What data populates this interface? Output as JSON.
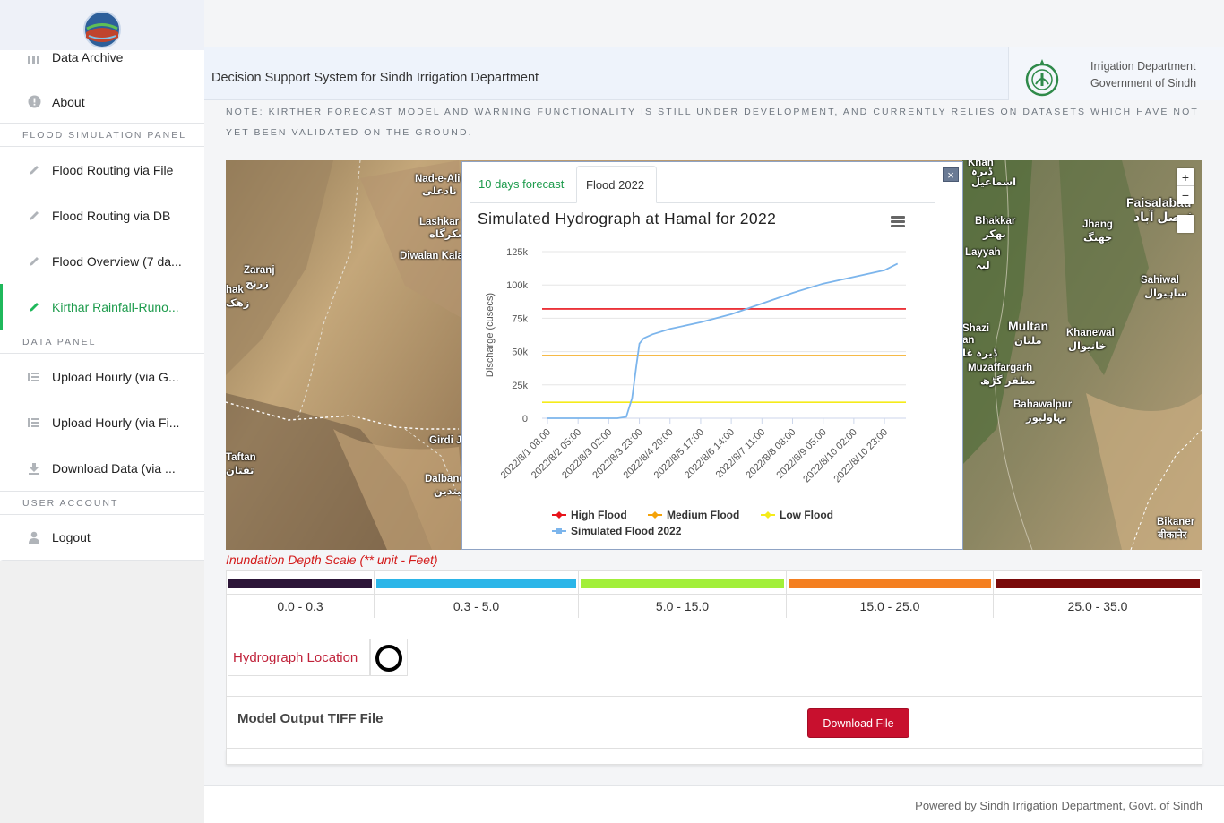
{
  "sidebar": {
    "items_top": [
      {
        "label": "Data Archive",
        "icon": "bar-icon"
      },
      {
        "label": "About",
        "icon": "info-icon"
      }
    ],
    "section_flood": "FLOOD SIMULATION PANEL",
    "flood_items": [
      {
        "label": "Flood Routing via File"
      },
      {
        "label": "Flood Routing via DB"
      },
      {
        "label": "Flood Overview (7 da..."
      },
      {
        "label": "Kirthar Rainfall-Runo..."
      }
    ],
    "section_data": "DATA PANEL",
    "data_items": [
      {
        "label": "Upload Hourly (via G..."
      },
      {
        "label": "Upload Hourly (via Fi..."
      },
      {
        "label": "Download Data (via ..."
      }
    ],
    "section_user": "USER ACCOUNT",
    "user_items": [
      {
        "label": "Logout"
      }
    ]
  },
  "header": {
    "title": "Decision Support System for Sindh Irrigation Department",
    "dept_line1": "Irrigation Department",
    "dept_line2": "Government of Sindh"
  },
  "note": "NOTE: KIRTHER FORECAST MODEL AND WARNING FUNCTIONALITY IS STILL UNDER DEVELOPMENT, AND CURRENTLY RELIES ON DATASETS WHICH HAVE NOT YET BEEN VALIDATED ON THE GROUND.",
  "map": {
    "zoom_in": "+",
    "zoom_out": "−",
    "labels_left": [
      "Nad-e-Ali",
      "نادعلی",
      "Lashkar",
      "لشکرگاه",
      "Diwalan Kala",
      "Zaranj",
      "زرنج",
      "hak",
      "زهک",
      "Girdi J",
      "Dalband",
      "دالبندین",
      "Taftan",
      "تفتان"
    ],
    "labels_right": [
      "Khan",
      "ڈیرہ",
      "اسماعیل",
      "Faisalabad",
      "فیصل آباد",
      "Bhakkar",
      "بھکر",
      "Jhang",
      "جھنگ",
      "Layyah",
      "لیہ",
      "Sahiwal",
      "ساہیوال",
      "Shazi",
      "an",
      "Multan",
      "ملتان",
      "Khanewal",
      "خانیوال",
      "Muzaffargarh",
      "مظفر گڑھ",
      "Bahawalpur",
      "بہاولپور",
      "Bikaner",
      "बीकानेर",
      "ڈیرہ غا"
    ]
  },
  "popup": {
    "tab1": "10 days forecast",
    "tab2": "Flood 2022",
    "close": "×",
    "chart_title": "Simulated Hydrograph at Hamal for 2022"
  },
  "chart_data": {
    "type": "line",
    "title": "Simulated Hydrograph at Hamal for 2022",
    "ylabel": "Discharge (cusecs)",
    "xlabel": "",
    "ylim": [
      0,
      125000
    ],
    "yticks": [
      "0",
      "25k",
      "50k",
      "75k",
      "100k",
      "125k"
    ],
    "xticks": [
      "2022/8/1 08:00",
      "2022/8/2 05:00",
      "2022/8/3 02:00",
      "2022/8/3 23:00",
      "2022/8/4 20:00",
      "2022/8/5 17:00",
      "2022/8/6 14:00",
      "2022/8/7 11:00",
      "2022/8/8 08:00",
      "2022/8/9 05:00",
      "2022/8/10 02:00",
      "2022/8/10 23:00"
    ],
    "thresholds": [
      {
        "name": "High Flood",
        "value": 82000,
        "color": "#e8141b"
      },
      {
        "name": "Medium Flood",
        "value": 47000,
        "color": "#f4a30a"
      },
      {
        "name": "Low Flood",
        "value": 12000,
        "color": "#f5eb1a"
      }
    ],
    "series": [
      {
        "name": "Simulated Flood 2022",
        "color": "#7cb5ec",
        "x": [
          "2022/8/1 08:00",
          "2022/8/2 05:00",
          "2022/8/3 02:00",
          "2022/8/3 08:00",
          "2022/8/3 14:00",
          "2022/8/3 18:00",
          "2022/8/3 21:00",
          "2022/8/3 23:00",
          "2022/8/4 02:00",
          "2022/8/4 08:00",
          "2022/8/4 20:00",
          "2022/8/5 17:00",
          "2022/8/6 14:00",
          "2022/8/7 11:00",
          "2022/8/8 08:00",
          "2022/8/9 05:00",
          "2022/8/10 02:00",
          "2022/8/10 23:00",
          "2022/8/11 08:00"
        ],
        "values": [
          0,
          0,
          0,
          0,
          1000,
          15000,
          40000,
          56000,
          60000,
          63000,
          67000,
          72000,
          78000,
          86000,
          94000,
          101000,
          106000,
          111000,
          116000
        ]
      }
    ]
  },
  "scale": {
    "title": "Inundation Depth Scale (** unit - Feet)",
    "ranges": [
      {
        "label": "0.0 - 0.3",
        "color": "#2c1538"
      },
      {
        "label": "0.3 - 5.0",
        "color": "#2bb5e8"
      },
      {
        "label": "5.0 - 15.0",
        "color": "#a2ef3a"
      },
      {
        "label": "15.0 - 25.0",
        "color": "#f47f20"
      },
      {
        "label": "25.0 - 35.0",
        "color": "#7a0a0a"
      }
    ]
  },
  "hydro_location": "Hydrograph Location",
  "tiff": {
    "label": "Model Output TIFF File",
    "button": "Download File"
  },
  "footer": "Powered by Sindh Irrigation Department, Govt. of Sindh"
}
